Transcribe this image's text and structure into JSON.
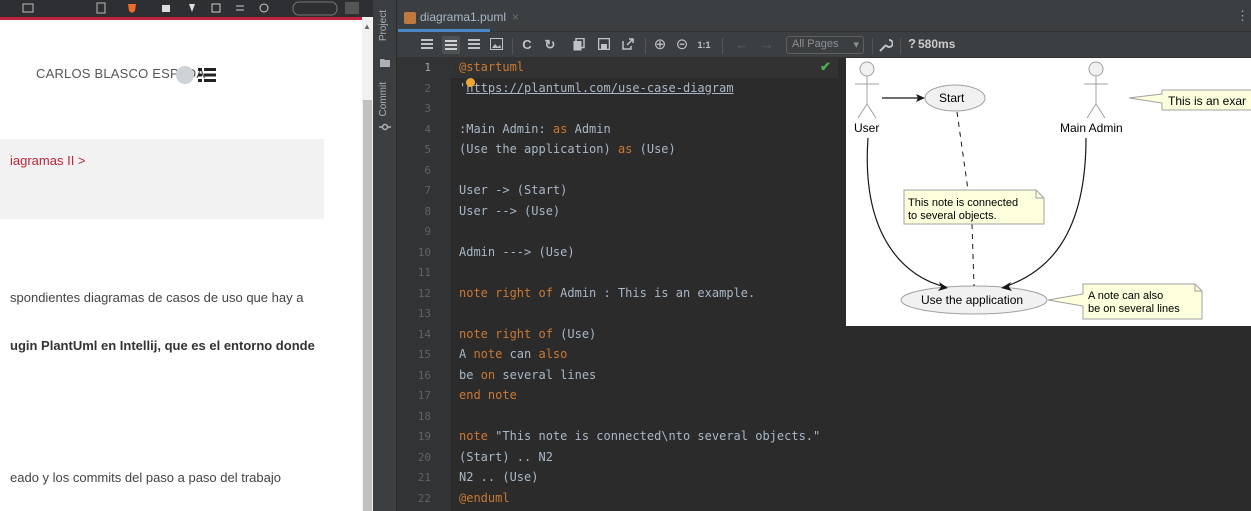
{
  "browser": {
    "author": "CARLOS BLASCO ESPADA",
    "breadcrumb": "iagramas II >",
    "paragraphs": [
      "spondientes diagramas de casos de uso que hay a",
      "ugin PlantUml en Intellij, que es el entorno donde",
      "eado y los commits del paso a paso del trabajo"
    ],
    "accent_color": "#c0233b"
  },
  "ide": {
    "side_tabs": [
      "Project",
      "Commit"
    ],
    "tab": {
      "label": "diagrama1.puml",
      "close": "×"
    },
    "toolbar": {
      "icons": [
        "align-left-icon",
        "align-split-icon",
        "align-center-icon",
        "image-icon",
        "reload-icon",
        "refresh-icon",
        "copy-icon",
        "save-icon",
        "open-external-icon",
        "zoom-in-icon",
        "zoom-out-icon",
        "actual-size-icon",
        "back-icon",
        "forward-icon"
      ],
      "reload": "C",
      "refresh": "↻",
      "zoom_in": "⊕",
      "zoom_out": "⊝",
      "actual": "1:1",
      "back": "←",
      "forward": "→",
      "pages": "All Pages",
      "help": "?",
      "timing": "580ms"
    },
    "line_numbers": [
      "1",
      "2",
      "3",
      "4",
      "5",
      "6",
      "7",
      "8",
      "9",
      "10",
      "11",
      "12",
      "13",
      "14",
      "15",
      "16",
      "17",
      "18",
      "19",
      "20",
      "21",
      "22"
    ],
    "code_lines": [
      [
        {
          "t": "@startuml",
          "c": "kw"
        }
      ],
      [
        {
          "t": "'",
          "c": ""
        },
        {
          "t": "https://plantuml.com/use-case-diagram",
          "c": "link"
        }
      ],
      [],
      [
        {
          "t": ":Main Admin: ",
          "c": ""
        },
        {
          "t": "as",
          "c": "kw"
        },
        {
          "t": " Admin",
          "c": ""
        }
      ],
      [
        {
          "t": "(Use the application) ",
          "c": ""
        },
        {
          "t": "as",
          "c": "kw"
        },
        {
          "t": " (Use)",
          "c": ""
        }
      ],
      [],
      [
        {
          "t": "User -> (Start)",
          "c": ""
        }
      ],
      [
        {
          "t": "User --> (Use)",
          "c": ""
        }
      ],
      [],
      [
        {
          "t": "Admin ---> (Use)",
          "c": ""
        }
      ],
      [],
      [
        {
          "t": "note right of",
          "c": "kw"
        },
        {
          "t": " Admin : This is an example.",
          "c": ""
        }
      ],
      [],
      [
        {
          "t": "note right of",
          "c": "kw"
        },
        {
          "t": " (Use)",
          "c": ""
        }
      ],
      [
        {
          "t": "A ",
          "c": ""
        },
        {
          "t": "note",
          "c": "kw"
        },
        {
          "t": " can ",
          "c": ""
        },
        {
          "t": "also",
          "c": "kw"
        }
      ],
      [
        {
          "t": "be ",
          "c": ""
        },
        {
          "t": "on",
          "c": "kw"
        },
        {
          "t": " several lines",
          "c": ""
        }
      ],
      [
        {
          "t": "end note",
          "c": "kw"
        }
      ],
      [],
      [
        {
          "t": "note",
          "c": "kw"
        },
        {
          "t": " \"This note is connected\\nto several objects.\"",
          "c": ""
        }
      ],
      [
        {
          "t": "(Start) .. N2",
          "c": ""
        }
      ],
      [
        {
          "t": "N2 .. (Use)",
          "c": ""
        }
      ],
      [
        {
          "t": "@enduml",
          "c": "kw"
        }
      ]
    ],
    "diagram": {
      "actor_user": "User",
      "actor_admin": "Main Admin",
      "usecase_start": "Start",
      "usecase_use": "Use the application",
      "note_admin": "This is an exar",
      "note_connected_1": "This note is connected",
      "note_connected_2": "to several objects.",
      "note_use_1": "A note can also",
      "note_use_2": "be on several lines"
    }
  }
}
